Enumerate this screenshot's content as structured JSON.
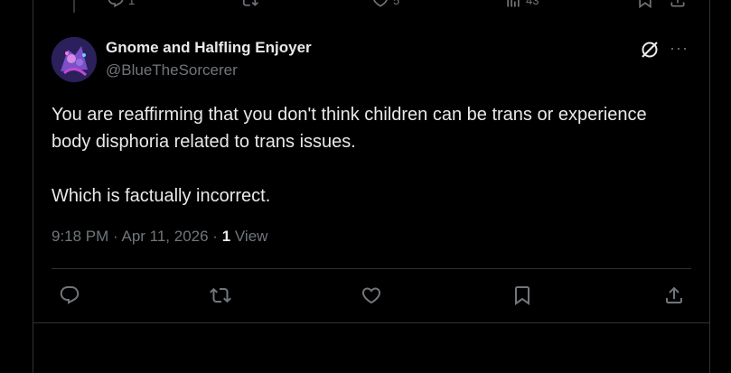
{
  "previous_tweet": {
    "reply_count": "1",
    "like_count": "5",
    "view_count": "43"
  },
  "tweet": {
    "author": {
      "display_name": "Gnome and Halfling Enjoyer",
      "handle": "@BlueTheSorcerer"
    },
    "text_paragraphs": [
      "You are reaffirming that you don't think children can be trans or experience body disphoria related to trans issues.",
      "Which is factually incorrect."
    ],
    "timestamp": "9:18 PM · Apr 11, 2026 · ",
    "view_count": "1",
    "view_label": " View"
  },
  "icons": {
    "grok": "grok-icon",
    "more": "more-icon",
    "reply": "reply-icon",
    "retweet": "retweet-icon",
    "like": "like-icon",
    "bookmark": "bookmark-icon",
    "share": "share-icon"
  },
  "colors": {
    "background": "#000000",
    "text": "#e7e9ea",
    "muted": "#71767b",
    "border": "#2f3336"
  }
}
